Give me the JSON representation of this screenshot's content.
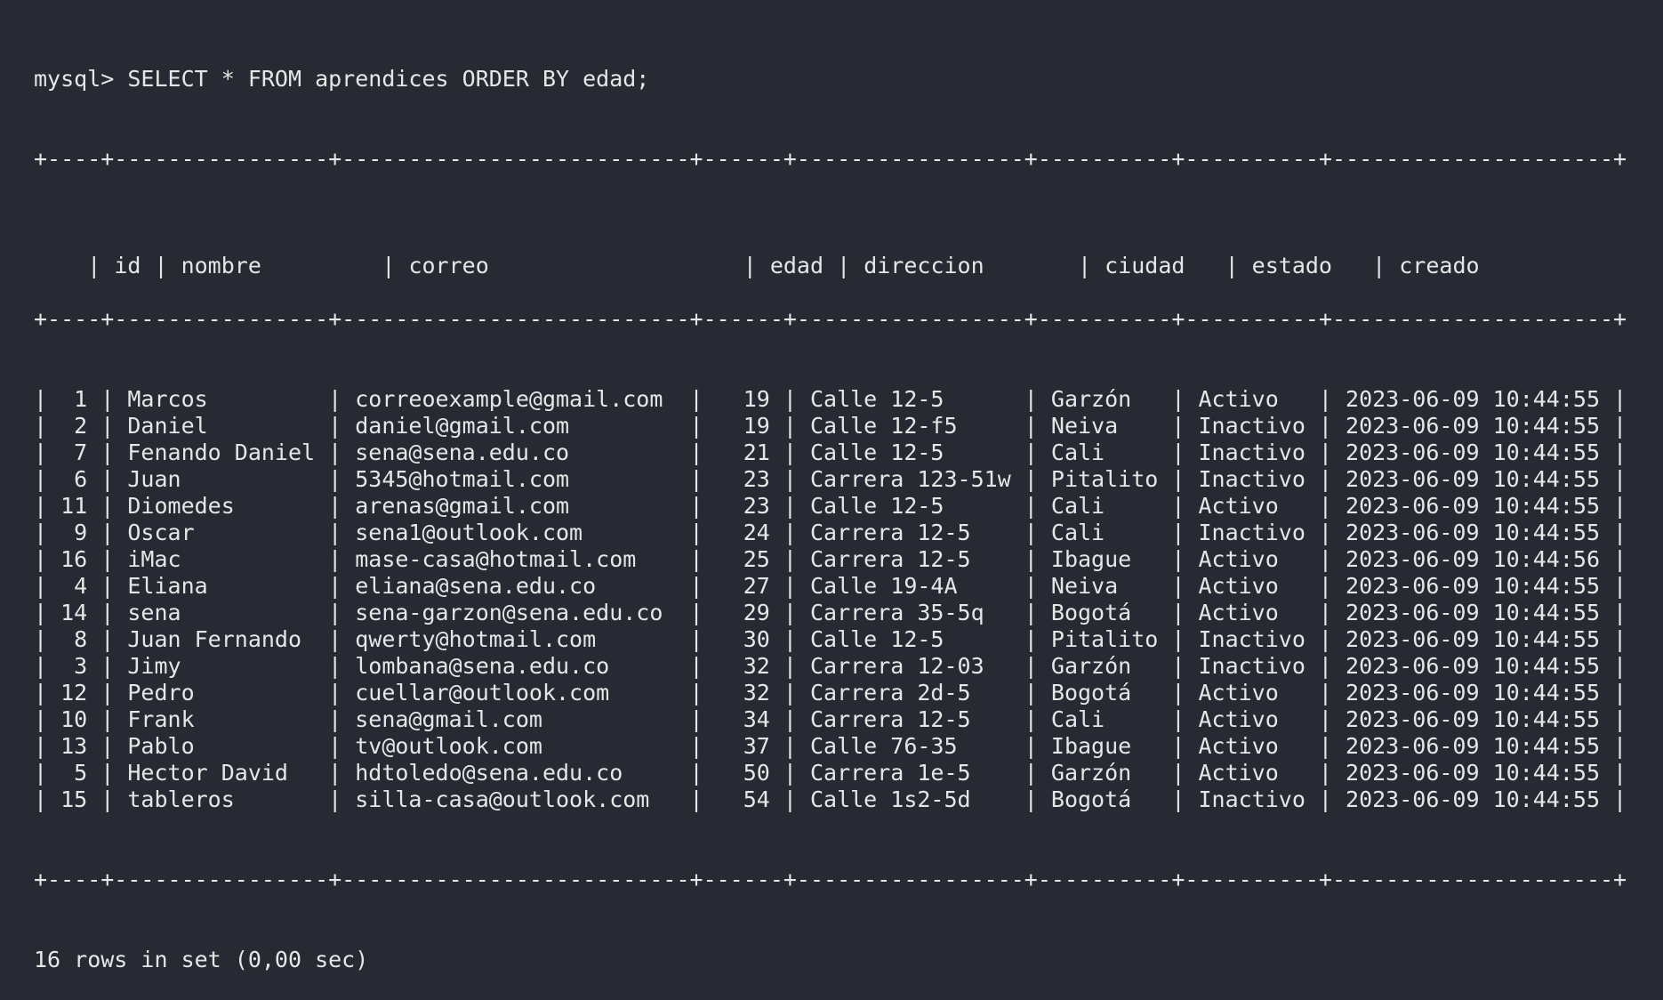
{
  "prompt": "mysql> SELECT * FROM aprendices ORDER BY edad;",
  "table": {
    "border": "+----+----------------+--------------------------+------+-----------------+----------+----------+---------------------+",
    "headers": [
      "id",
      "nombre",
      "correo",
      "edad",
      "direccion",
      "ciudad",
      "estado",
      "creado"
    ],
    "rows": [
      [
        "1",
        "Marcos",
        "correoexample@gmail.com",
        "19",
        "Calle 12-5",
        "Garzón",
        "Activo",
        "2023-06-09 10:44:55"
      ],
      [
        "2",
        "Daniel",
        "daniel@gmail.com",
        "19",
        "Calle 12-f5",
        "Neiva",
        "Inactivo",
        "2023-06-09 10:44:55"
      ],
      [
        "7",
        "Fenando Daniel",
        "sena@sena.edu.co",
        "21",
        "Calle 12-5",
        "Cali",
        "Inactivo",
        "2023-06-09 10:44:55"
      ],
      [
        "6",
        "Juan",
        "5345@hotmail.com",
        "23",
        "Carrera 123-51w",
        "Pitalito",
        "Inactivo",
        "2023-06-09 10:44:55"
      ],
      [
        "11",
        "Diomedes",
        "arenas@gmail.com",
        "23",
        "Calle 12-5",
        "Cali",
        "Activo",
        "2023-06-09 10:44:55"
      ],
      [
        "9",
        "Oscar",
        "sena1@outlook.com",
        "24",
        "Carrera 12-5",
        "Cali",
        "Inactivo",
        "2023-06-09 10:44:55"
      ],
      [
        "16",
        "iMac",
        "mase-casa@hotmail.com",
        "25",
        "Carrera 12-5",
        "Ibague",
        "Activo",
        "2023-06-09 10:44:56"
      ],
      [
        "4",
        "Eliana",
        "eliana@sena.edu.co",
        "27",
        "Calle 19-4A",
        "Neiva",
        "Activo",
        "2023-06-09 10:44:55"
      ],
      [
        "14",
        "sena",
        "sena-garzon@sena.edu.co",
        "29",
        "Carrera 35-5q",
        "Bogotá",
        "Activo",
        "2023-06-09 10:44:55"
      ],
      [
        "8",
        "Juan Fernando",
        "qwerty@hotmail.com",
        "30",
        "Calle 12-5",
        "Pitalito",
        "Inactivo",
        "2023-06-09 10:44:55"
      ],
      [
        "3",
        "Jimy",
        "lombana@sena.edu.co",
        "32",
        "Carrera 12-03",
        "Garzón",
        "Inactivo",
        "2023-06-09 10:44:55"
      ],
      [
        "12",
        "Pedro",
        "cuellar@outlook.com",
        "32",
        "Carrera 2d-5",
        "Bogotá",
        "Activo",
        "2023-06-09 10:44:55"
      ],
      [
        "10",
        "Frank",
        "sena@gmail.com",
        "34",
        "Carrera 12-5",
        "Cali",
        "Activo",
        "2023-06-09 10:44:55"
      ],
      [
        "13",
        "Pablo",
        "tv@outlook.com",
        "37",
        "Calle 76-35",
        "Ibague",
        "Activo",
        "2023-06-09 10:44:55"
      ],
      [
        "5",
        "Hector David",
        "hdtoledo@sena.edu.co",
        "50",
        "Carrera 1e-5",
        "Garzón",
        "Activo",
        "2023-06-09 10:44:55"
      ],
      [
        "15",
        "tableros",
        "silla-casa@outlook.com",
        "54",
        "Calle 1s2-5d",
        "Bogotá",
        "Inactivo",
        "2023-06-09 10:44:55"
      ]
    ]
  },
  "footer": "16 rows in set (0,00 sec)"
}
